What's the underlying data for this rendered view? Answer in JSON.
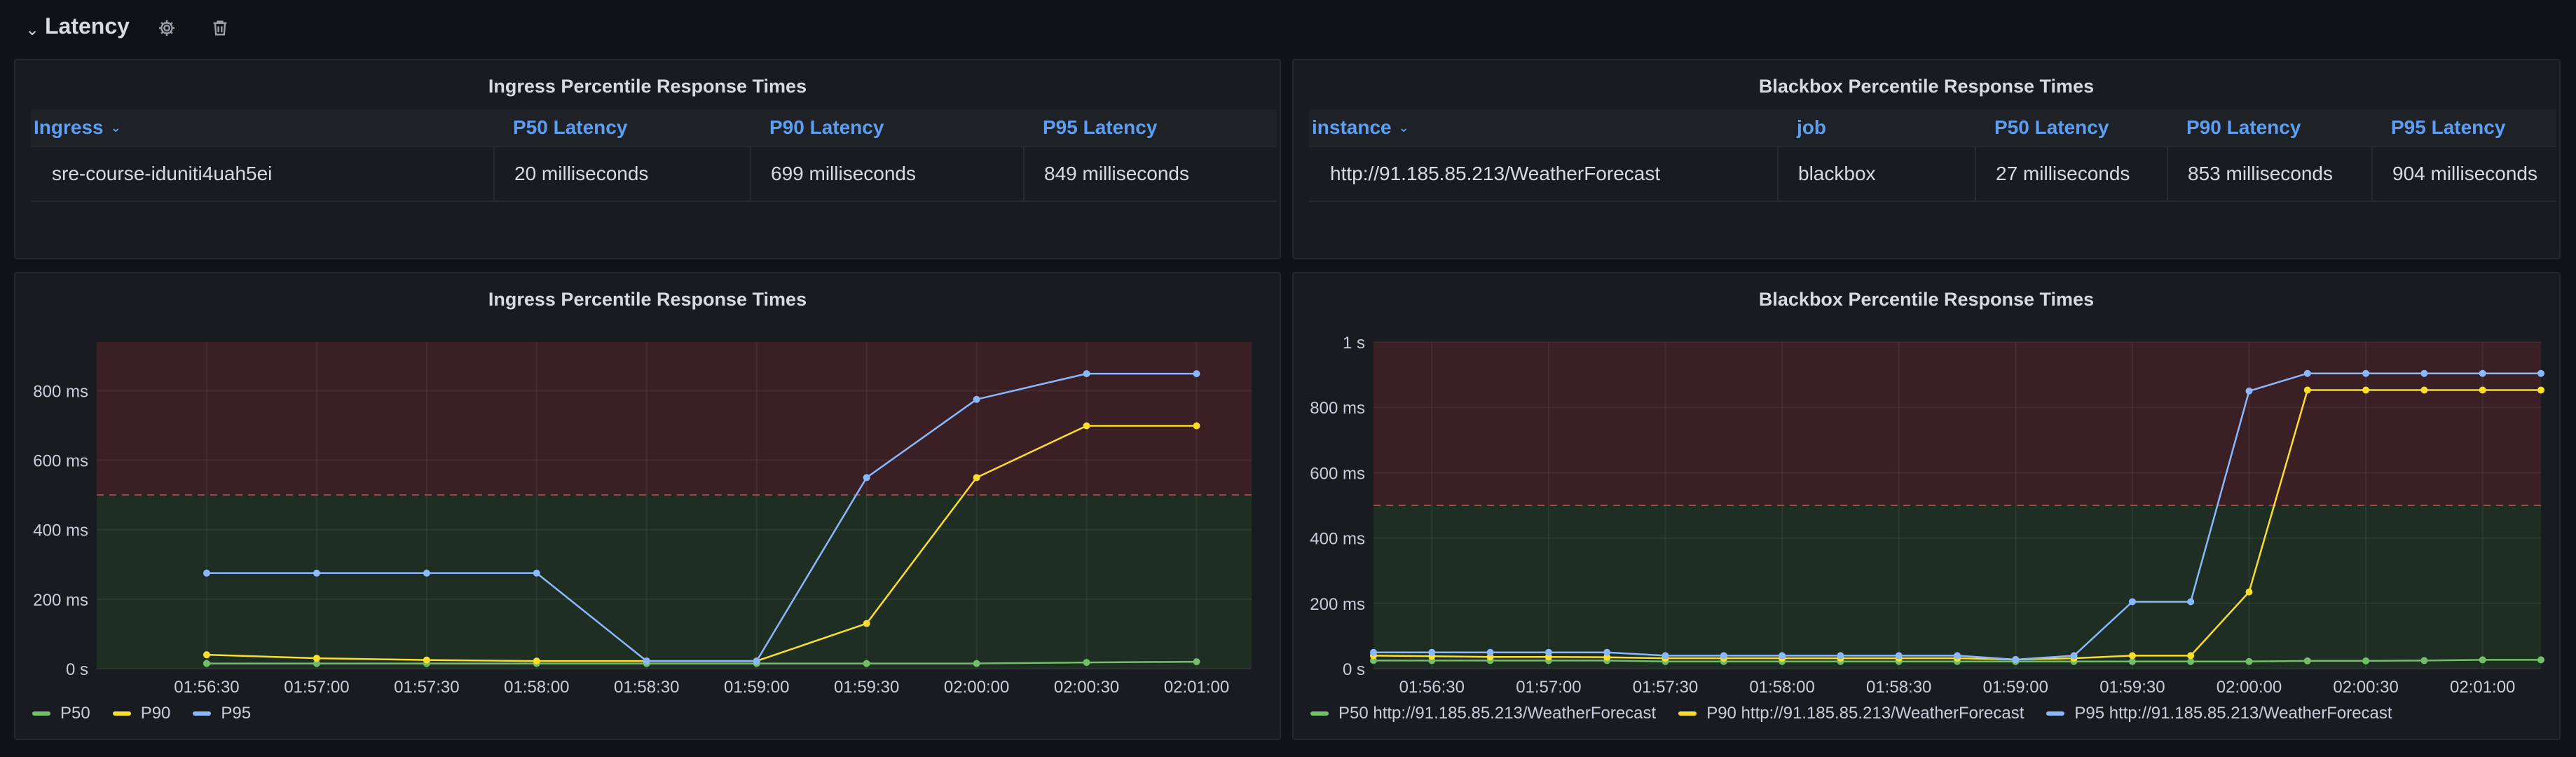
{
  "row": {
    "title": "Latency",
    "toggle_icon": "chevron-down-icon",
    "settings_icon": "gear-icon",
    "delete_icon": "trash-icon"
  },
  "colors": {
    "p50": "#73bf69",
    "p90": "#fade2a",
    "p95": "#8ab8ff",
    "header_text": "#5d9ef2",
    "threshold_red": "#3a1f24",
    "threshold_green": "#1e2e22"
  },
  "ingress_table": {
    "title": "Ingress Percentile Response Times",
    "columns": [
      "Ingress",
      "P50 Latency",
      "P90 Latency",
      "P95 Latency"
    ],
    "rows": [
      [
        "sre-course-iduniti4uah5ei",
        "20 milliseconds",
        "699 milliseconds",
        "849 milliseconds"
      ]
    ]
  },
  "blackbox_table": {
    "title": "Blackbox Percentile Response Times",
    "columns": [
      "instance",
      "job",
      "P50 Latency",
      "P90 Latency",
      "P95 Latency"
    ],
    "rows": [
      [
        "http://91.185.85.213/WeatherForecast",
        "blackbox",
        "27 milliseconds",
        "853 milliseconds",
        "904 milliseconds"
      ]
    ]
  },
  "ingress_chart": {
    "title": "Ingress Percentile Response Times",
    "legend": [
      "P50",
      "P90",
      "P95"
    ]
  },
  "blackbox_chart": {
    "title": "Blackbox Percentile Response Times",
    "legend": [
      "P50 http://91.185.85.213/WeatherForecast",
      "P90 http://91.185.85.213/WeatherForecast",
      "P95 http://91.185.85.213/WeatherForecast"
    ]
  },
  "chart_data": [
    {
      "type": "line",
      "title": "Ingress Percentile Response Times",
      "ylim": [
        0,
        940
      ],
      "threshold": 500,
      "grid": true,
      "legend_position": "bottom-left",
      "y_ticks": [
        {
          "value": 0,
          "label": "0 s"
        },
        {
          "value": 200,
          "label": "200 ms"
        },
        {
          "value": 400,
          "label": "400 ms"
        },
        {
          "value": 600,
          "label": "600 ms"
        },
        {
          "value": 800,
          "label": "800 ms"
        }
      ],
      "x_ticks": [
        "01:56:30",
        "01:57:00",
        "01:57:30",
        "01:58:00",
        "01:58:30",
        "01:59:00",
        "01:59:30",
        "02:00:00",
        "02:00:30",
        "02:01:00"
      ],
      "x": [
        "01:56:30",
        "01:57:00",
        "01:57:30",
        "01:58:00",
        "01:58:30",
        "01:59:00",
        "01:59:30",
        "02:00:00",
        "02:00:30",
        "02:01:00"
      ],
      "series": [
        {
          "name": "P50",
          "values": [
            15,
            15,
            15,
            15,
            15,
            15,
            15,
            15,
            18,
            20
          ]
        },
        {
          "name": "P90",
          "values": [
            40,
            30,
            25,
            22,
            22,
            22,
            130,
            550,
            699,
            699
          ]
        },
        {
          "name": "P95",
          "values": [
            275,
            275,
            275,
            275,
            22,
            22,
            550,
            775,
            849,
            849
          ]
        }
      ]
    },
    {
      "type": "line",
      "title": "Blackbox Percentile Response Times",
      "ylim": [
        0,
        1000
      ],
      "threshold": 500,
      "grid": true,
      "legend_position": "bottom-left",
      "y_ticks": [
        {
          "value": 0,
          "label": "0 s"
        },
        {
          "value": 200,
          "label": "200 ms"
        },
        {
          "value": 400,
          "label": "400 ms"
        },
        {
          "value": 600,
          "label": "600 ms"
        },
        {
          "value": 800,
          "label": "800 ms"
        },
        {
          "value": 1000,
          "label": "1 s"
        }
      ],
      "x_ticks": [
        "01:56:30",
        "01:57:00",
        "01:57:30",
        "01:58:00",
        "01:58:30",
        "01:59:00",
        "01:59:30",
        "02:00:00",
        "02:00:30",
        "02:01:00"
      ],
      "x": [
        "01:56:15",
        "01:56:30",
        "01:56:45",
        "01:57:00",
        "01:57:15",
        "01:57:30",
        "01:57:45",
        "01:58:00",
        "01:58:15",
        "01:58:30",
        "01:58:45",
        "01:59:00",
        "01:59:15",
        "01:59:30",
        "01:59:45",
        "02:00:00",
        "02:00:15",
        "02:00:30",
        "02:00:45",
        "02:01:00",
        "02:01:15"
      ],
      "series": [
        {
          "name": "P50 http://91.185.85.213/WeatherForecast",
          "values": [
            25,
            25,
            25,
            25,
            25,
            22,
            22,
            22,
            22,
            22,
            22,
            22,
            22,
            22,
            22,
            22,
            24,
            24,
            25,
            27,
            27
          ]
        },
        {
          "name": "P90 http://91.185.85.213/WeatherForecast",
          "values": [
            40,
            38,
            36,
            36,
            35,
            32,
            32,
            32,
            32,
            32,
            32,
            28,
            32,
            40,
            40,
            235,
            853,
            853,
            853,
            853,
            853
          ]
        },
        {
          "name": "P95 http://91.185.85.213/WeatherForecast",
          "values": [
            50,
            50,
            50,
            50,
            50,
            40,
            40,
            40,
            40,
            40,
            40,
            28,
            40,
            205,
            205,
            850,
            904,
            904,
            904,
            904,
            904
          ]
        }
      ]
    }
  ]
}
